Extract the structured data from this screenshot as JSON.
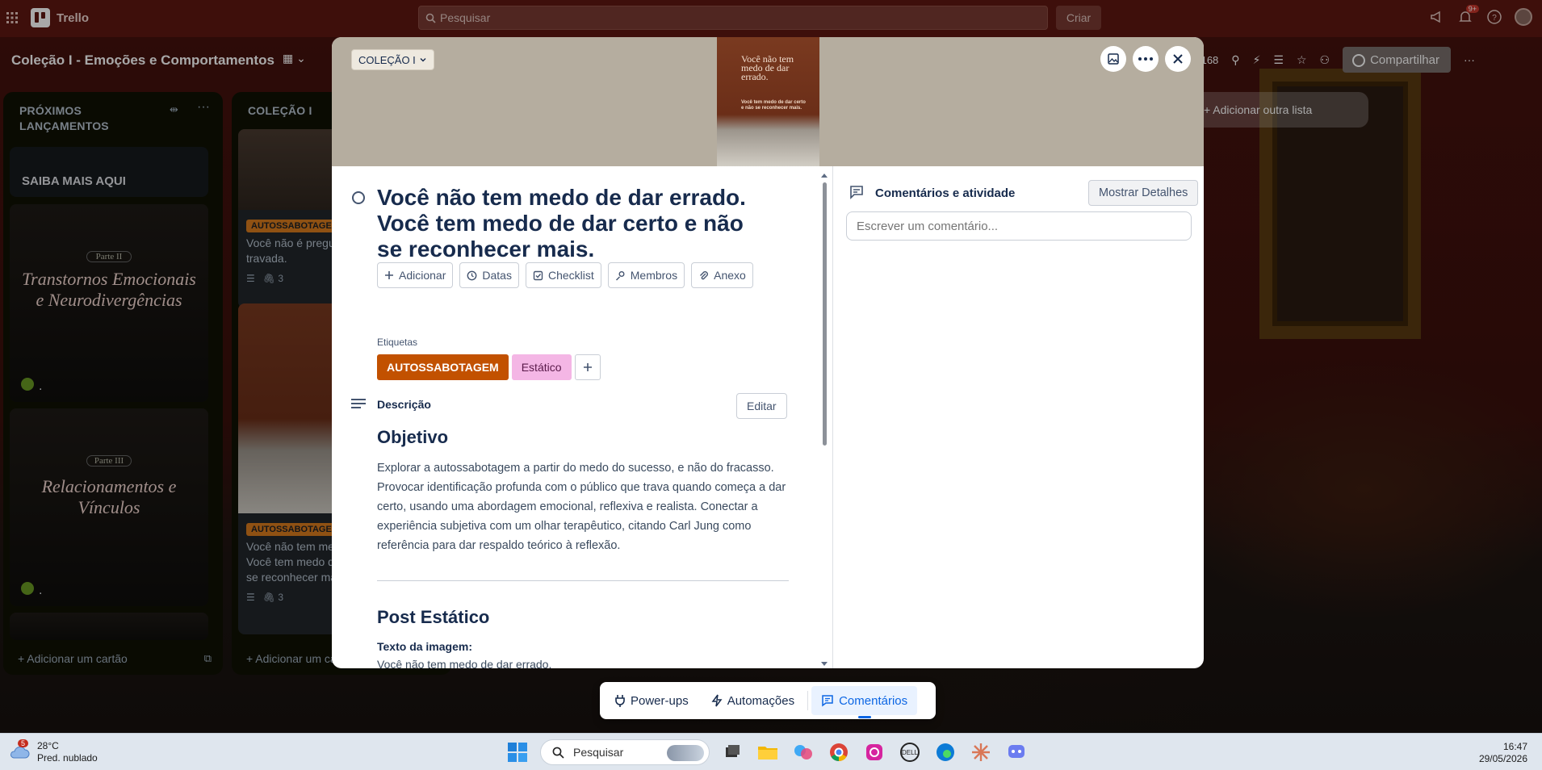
{
  "topbar": {
    "app_name": "Trello",
    "search_placeholder": "Pesquisar",
    "create_label": "Criar",
    "notification_count": "9+"
  },
  "board": {
    "title": "Coleção I - Emoções e Comportamentos",
    "member_count": "+168",
    "share_label": "Compartilhar",
    "add_list_label": "Adicionar outra lista"
  },
  "lists": [
    {
      "title": "PRÓXIMOS LANÇAMENTOS",
      "cards": [
        {
          "title": "SAIBA MAIS AQUI"
        },
        {
          "part": "Parte II",
          "art_title": "Transtornos Emocionais e Neurodivergências",
          "footer": "."
        },
        {
          "part": "Parte III",
          "art_title": "Relacionamentos e Vínculos",
          "footer": "."
        }
      ],
      "add_card_label": "Adicionar um cartão"
    },
    {
      "title": "COLEÇÃO I",
      "cards": [
        {
          "label": "AUTOSSABOTAGEM",
          "snippet": "Você não é preguiçosa. Você está travada.",
          "attachments": "3"
        },
        {
          "label": "AUTOSSABOTAGEM",
          "snippet": "Você não tem medo de dar errado. Você tem medo de dar certo e não se reconhecer mais.",
          "attachments": "3"
        }
      ],
      "add_card_label": "Adicionar um cartão"
    }
  ],
  "modal": {
    "list_selector": "COLEÇÃO I",
    "cover_headline": "Você não tem medo de dar errado.",
    "cover_subline": "Você tem medo de dar certo e não se reconhecer mais.",
    "title": "Você não tem medo de dar errado. Você tem medo de dar certo e não se reconhecer mais.",
    "actions": [
      {
        "label": "Adicionar",
        "icon": "plus-icon"
      },
      {
        "label": "Datas",
        "icon": "clock-icon"
      },
      {
        "label": "Checklist",
        "icon": "checkbox-icon"
      },
      {
        "label": "Membros",
        "icon": "person-icon"
      },
      {
        "label": "Anexo",
        "icon": "paperclip-icon"
      }
    ],
    "labels_heading": "Etiquetas",
    "labels": [
      {
        "name": "AUTOSSABOTAGEM",
        "color": "#c25100"
      },
      {
        "name": "Estático",
        "color": "#f4b6e5"
      }
    ],
    "description_heading": "Descrição",
    "edit_label": "Editar",
    "description": {
      "heading_1": "Objetivo",
      "paragraph_1": "Explorar a autossabotagem a partir do medo do sucesso, e não do fracasso. Provocar identificação profunda com o público que trava quando começa a dar certo, usando uma abordagem emocional, reflexiva e realista. Conectar a experiência subjetiva com um olhar terapêutico, citando Carl Jung como referência para dar respaldo teórico à reflexão.",
      "heading_2": "Post Estático",
      "image_text_label": "Texto da imagem:",
      "image_text_value": "Você não tem medo de dar errado."
    },
    "comments": {
      "heading": "Comentários e atividade",
      "show_details_label": "Mostrar Detalhes",
      "input_placeholder": "Escrever um comentário..."
    }
  },
  "floating_bar": {
    "powerups_label": "Power-ups",
    "automations_label": "Automações",
    "comments_label": "Comentários"
  },
  "taskbar": {
    "weather_temp": "28°C",
    "weather_desc": "Pred. nublado",
    "weather_badge": "5",
    "search_placeholder": "Pesquisar",
    "time": "16:47",
    "date": "29/05/2026"
  },
  "colors": {
    "accent_blue": "#0c66e4",
    "label_orange": "#c25100",
    "label_pink": "#f4b6e5",
    "topbar_bg": "#5e1711"
  }
}
